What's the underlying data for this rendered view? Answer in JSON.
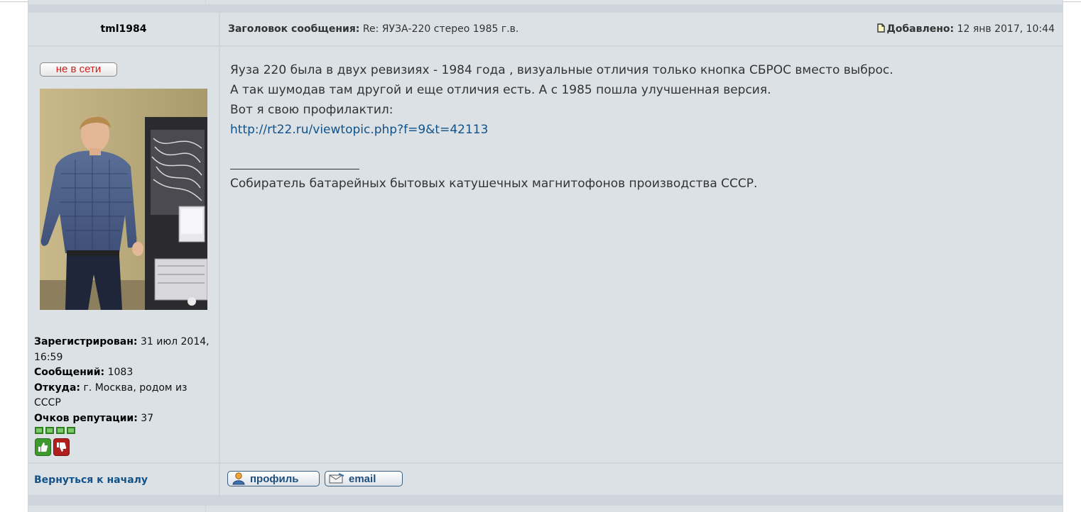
{
  "post": {
    "author": "tml1984",
    "subject_label": "Заголовок сообщения:",
    "subject": "Re: ЯУЗА-220 стерео 1985 г.в.",
    "posted_label": "Добавлено:",
    "posted": "12 янв 2017, 10:44",
    "status_badge": "не в сети",
    "profile": {
      "registered_label": "Зарегистрирован:",
      "registered": "31 июл 2014, 16:59",
      "posts_label": "Сообщений:",
      "posts": "1083",
      "location_label": "Откуда:",
      "location": "г. Москва, родом из СССР",
      "reputation_label": "Очков репутации:",
      "reputation": "37"
    },
    "body": {
      "line1": "Яуза 220 была в двух ревизиях - 1984 года , визуальные отличия только кнопка СБРОС вместо выброс.",
      "line2": "А так шумодав там другой и еще отличия есть. А с 1985 пошла улучшенная версия.",
      "line3": "Вот я свою профилактил:",
      "link": "http://rt22.ru/viewtopic.php?f=9&t=42113",
      "signature": "Собиратель батарейных бытовых катушечных магнитофонов производства СССР."
    },
    "footer": {
      "back_to_top": "Вернуться к началу",
      "profile_button": "профиль",
      "email_button": "email"
    }
  },
  "colors": {
    "row_bg": "#dce1e5",
    "border": "#ced5dc",
    "link": "#105289",
    "offline": "#cc2020",
    "rank_green": "#7cc96a"
  },
  "icons": [
    "post-icon",
    "profile-icon",
    "email-icon",
    "thumbs-up-icon",
    "thumbs-down-icon",
    "rank-square-icon"
  ]
}
